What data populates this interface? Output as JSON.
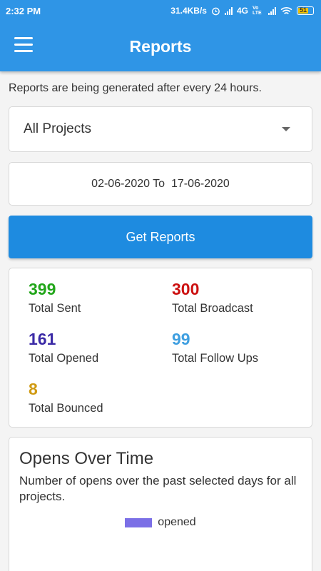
{
  "status_bar": {
    "time": "2:32 PM",
    "network_speed": "31.4KB/s",
    "network_type": "4G",
    "lte_label": "Vo LTE",
    "battery": "51"
  },
  "app_bar": {
    "title": "Reports",
    "menu_icon": "hamburger-menu-icon"
  },
  "notice": "Reports are being generated after every 24 hours.",
  "project_select": {
    "value": "All Projects"
  },
  "date_range": {
    "text": "02-06-2020 To  17-06-2020"
  },
  "get_reports_label": "Get Reports",
  "stats": {
    "total_sent": {
      "value": "399",
      "label": "Total Sent",
      "color": "#22a61a"
    },
    "total_broadcast": {
      "value": "300",
      "label": "Total Broadcast",
      "color": "#cc1111"
    },
    "total_opened": {
      "value": "161",
      "label": "Total Opened",
      "color": "#3b2aa6"
    },
    "total_follow_ups": {
      "value": "99",
      "label": "Total Follow Ups",
      "color": "#3f9fe0"
    },
    "total_bounced": {
      "value": "8",
      "label": "Total Bounced",
      "color": "#d09a12"
    }
  },
  "opens_chart": {
    "title": "Opens Over Time",
    "subtitle": "Number of opens over the past selected days for all projects.",
    "legend_label": "opened",
    "legend_color": "#7b6fe6"
  }
}
